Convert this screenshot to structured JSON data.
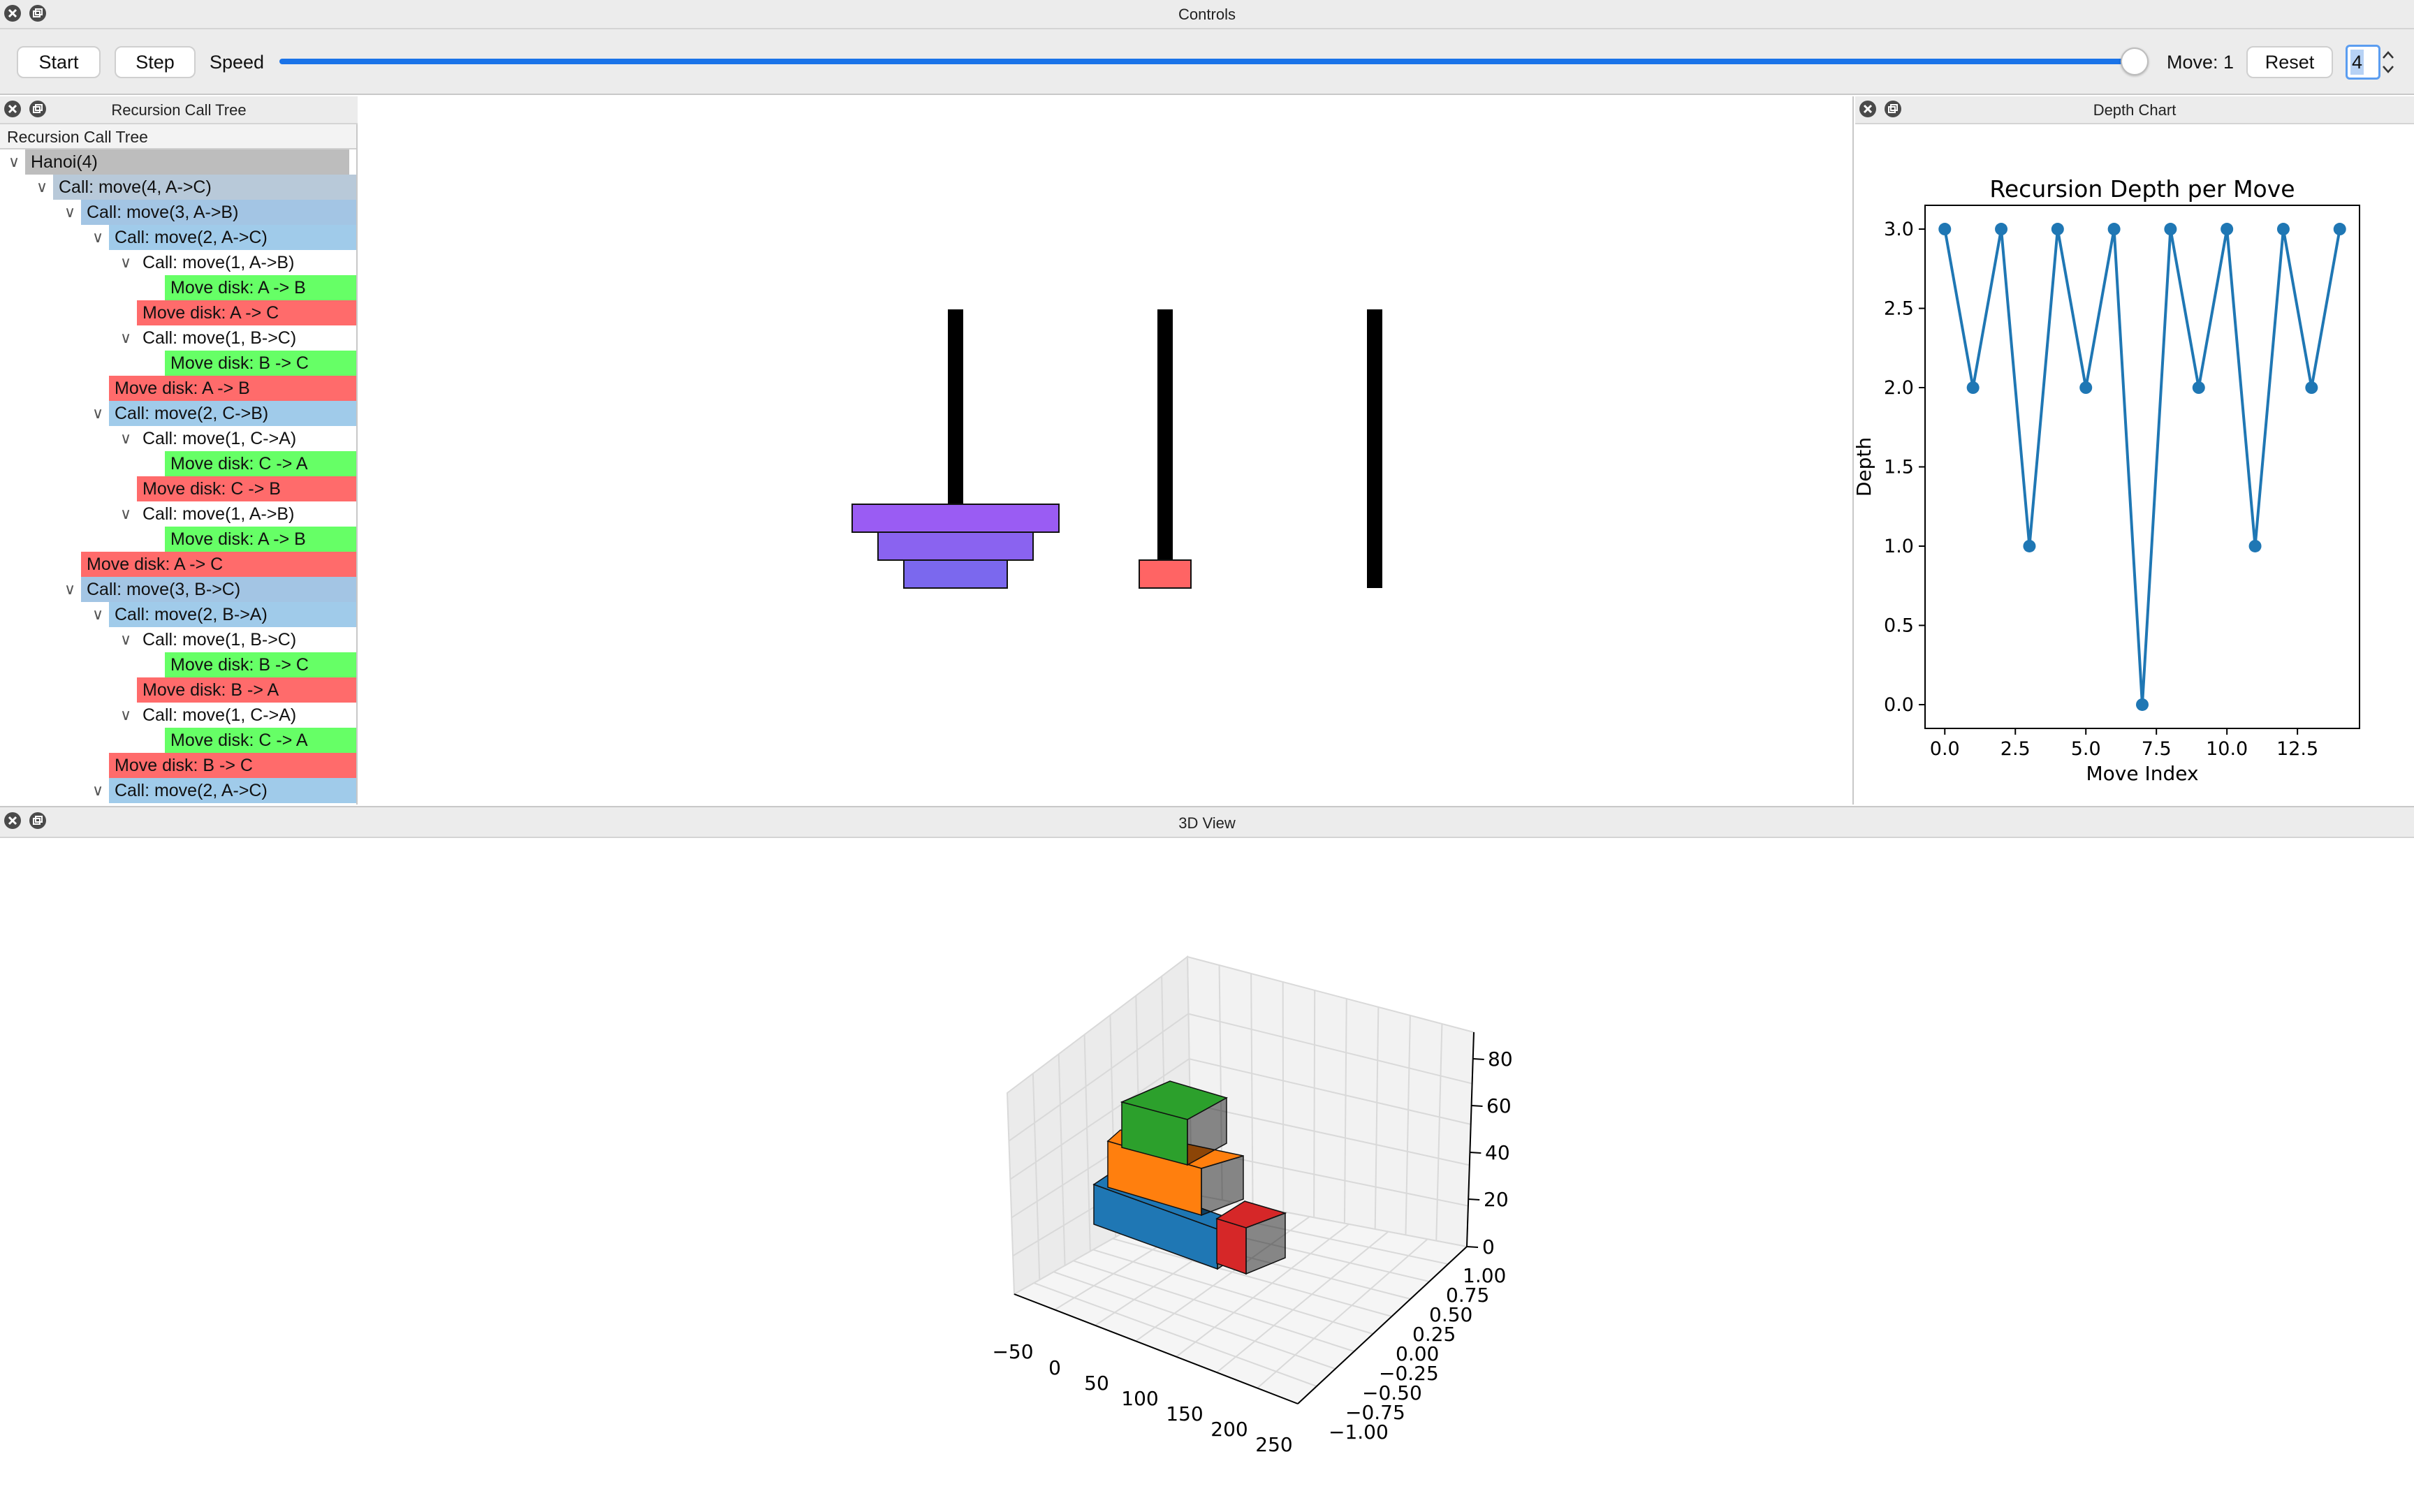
{
  "controls": {
    "window_title": "Controls",
    "start_label": "Start",
    "step_label": "Step",
    "speed_label": "Speed",
    "speed_value": 1.0,
    "move_label": "Move: 1",
    "reset_label": "Reset",
    "n_value": "4"
  },
  "tree_panel": {
    "window_title": "Recursion Call Tree",
    "header": "Recursion Call Tree",
    "rows": [
      {
        "text": "Hanoi(4)",
        "depth": 0,
        "expandable": true,
        "kind": "root"
      },
      {
        "text": "Call: move(4, A->C)",
        "depth": 1,
        "expandable": true,
        "kind": "call1"
      },
      {
        "text": "Call: move(3, A->B)",
        "depth": 2,
        "expandable": true,
        "kind": "call2"
      },
      {
        "text": "Call: move(2, A->C)",
        "depth": 3,
        "expandable": true,
        "kind": "call3"
      },
      {
        "text": "Call: move(1, A->B)",
        "depth": 4,
        "expandable": true,
        "kind": "call4"
      },
      {
        "text": "Move disk: A -> B",
        "depth": 5,
        "expandable": false,
        "kind": "green"
      },
      {
        "text": "Move disk: A -> C",
        "depth": 4,
        "expandable": false,
        "kind": "red"
      },
      {
        "text": "Call: move(1, B->C)",
        "depth": 4,
        "expandable": true,
        "kind": "call4"
      },
      {
        "text": "Move disk: B -> C",
        "depth": 5,
        "expandable": false,
        "kind": "green"
      },
      {
        "text": "Move disk: A -> B",
        "depth": 3,
        "expandable": false,
        "kind": "red"
      },
      {
        "text": "Call: move(2, C->B)",
        "depth": 3,
        "expandable": true,
        "kind": "call3"
      },
      {
        "text": "Call: move(1, C->A)",
        "depth": 4,
        "expandable": true,
        "kind": "call4"
      },
      {
        "text": "Move disk: C -> A",
        "depth": 5,
        "expandable": false,
        "kind": "green"
      },
      {
        "text": "Move disk: C -> B",
        "depth": 4,
        "expandable": false,
        "kind": "red"
      },
      {
        "text": "Call: move(1, A->B)",
        "depth": 4,
        "expandable": true,
        "kind": "call4"
      },
      {
        "text": "Move disk: A -> B",
        "depth": 5,
        "expandable": false,
        "kind": "green"
      },
      {
        "text": "Move disk: A -> C",
        "depth": 2,
        "expandable": false,
        "kind": "red"
      },
      {
        "text": "Call: move(3, B->C)",
        "depth": 2,
        "expandable": true,
        "kind": "call2"
      },
      {
        "text": "Call: move(2, B->A)",
        "depth": 3,
        "expandable": true,
        "kind": "call3"
      },
      {
        "text": "Call: move(1, B->C)",
        "depth": 4,
        "expandable": true,
        "kind": "call4"
      },
      {
        "text": "Move disk: B -> C",
        "depth": 5,
        "expandable": false,
        "kind": "green"
      },
      {
        "text": "Move disk: B -> A",
        "depth": 4,
        "expandable": false,
        "kind": "red"
      },
      {
        "text": "Call: move(1, C->A)",
        "depth": 4,
        "expandable": true,
        "kind": "call4"
      },
      {
        "text": "Move disk: C -> A",
        "depth": 5,
        "expandable": false,
        "kind": "green"
      },
      {
        "text": "Move disk: B -> C",
        "depth": 3,
        "expandable": false,
        "kind": "red"
      },
      {
        "text": "Call: move(2, A->C)",
        "depth": 3,
        "expandable": true,
        "kind": "call3"
      }
    ]
  },
  "hanoi_view": {
    "pegs": [
      "A",
      "B",
      "C"
    ],
    "disks": [
      {
        "peg": "A",
        "level": 0,
        "size": 2,
        "color": "#7b68ee"
      },
      {
        "peg": "A",
        "level": 1,
        "size": 3,
        "color": "#8a63f0"
      },
      {
        "peg": "A",
        "level": 2,
        "size": 4,
        "color": "#9a5cf3"
      },
      {
        "peg": "B",
        "level": 0,
        "size": 1,
        "color": "#ff6464"
      }
    ]
  },
  "depth_panel": {
    "window_title": "Depth Chart"
  },
  "chart_data": {
    "type": "line",
    "title": "Recursion Depth per Move",
    "xlabel": "Move Index",
    "ylabel": "Depth",
    "x": [
      0,
      1,
      2,
      3,
      4,
      5,
      6,
      7,
      8,
      9,
      10,
      11,
      12,
      13,
      14
    ],
    "y": [
      3,
      2,
      3,
      1,
      3,
      2,
      3,
      0,
      3,
      2,
      3,
      1,
      3,
      2,
      3
    ],
    "xlim": [
      -0.7,
      14.7
    ],
    "ylim": [
      -0.15,
      3.15
    ],
    "xticks": [
      "0.0",
      "2.5",
      "5.0",
      "7.5",
      "10.0",
      "12.5"
    ],
    "yticks": [
      "0.0",
      "0.5",
      "1.0",
      "1.5",
      "2.0",
      "2.5",
      "3.0"
    ],
    "color": "#1f77b4",
    "marker": "circle"
  },
  "view3d": {
    "window_title": "3D View",
    "z_ticks": [
      "0",
      "20",
      "40",
      "60",
      "80"
    ],
    "x_ticks": [
      "−50",
      "0",
      "50",
      "100",
      "150",
      "200",
      "250"
    ],
    "y_ticks": [
      "1.00",
      "0.75",
      "0.50",
      "0.25",
      "0.00",
      "−0.25",
      "−0.50",
      "−0.75",
      "−1.00"
    ],
    "colors": {
      "blue": "#1f77b4",
      "orange": "#ff7f0e",
      "green": "#2ca02c",
      "red": "#d62728"
    }
  }
}
